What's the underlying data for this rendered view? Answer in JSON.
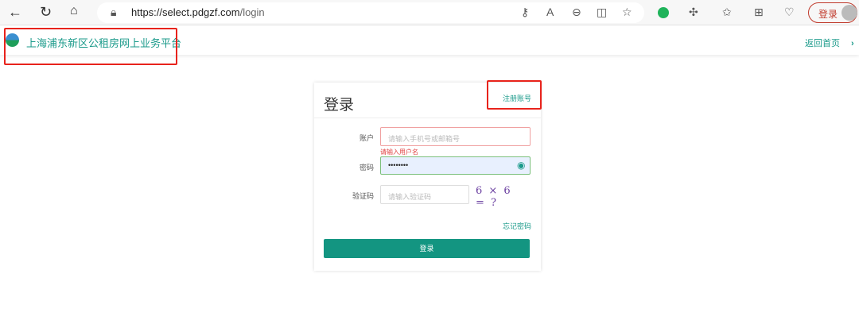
{
  "browser": {
    "url_host": "https://select.pdgzf.com",
    "url_path": "/login",
    "profile_login": "登录"
  },
  "site": {
    "title": "上海浦东新区公租房网上业务平台",
    "home_link": "返回首页",
    "home_chevron": "›"
  },
  "login": {
    "title": "登录",
    "register": "注册账号",
    "account_label": "账户",
    "account_placeholder": "请输入手机号或邮箱号",
    "account_error": "请输入用户名",
    "password_label": "密码",
    "password_value": "••••••••",
    "captcha_label": "验证码",
    "captcha_placeholder": "请输入验证码",
    "captcha_text": "6 × 6 = ?",
    "forgot": "忘记密码",
    "submit": "登录"
  }
}
